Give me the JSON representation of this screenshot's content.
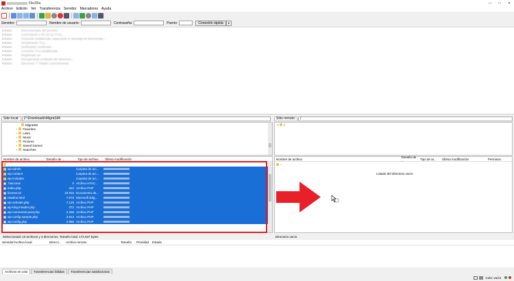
{
  "window": {
    "title": "FileZilla",
    "controls": {
      "minimize": "—",
      "maximize": "□",
      "close": "✕"
    }
  },
  "menu": [
    "Archivo",
    "Edición",
    "Ver",
    "Transferencia",
    "Servidor",
    "Marcadores",
    "Ayuda"
  ],
  "quickconnect": {
    "host_label": "Servidor:",
    "user_label": "Nombre de usuario:",
    "pass_label": "Contraseña:",
    "port_label": "Puerto:",
    "button": "Conexión rápida",
    "dropdown": "▾"
  },
  "log": [
    {
      "k": "Estado:",
      "v": "Desconectado del servidor"
    },
    {
      "k": "Estado:",
      "v": "Conectando a 94.23.12.77:21..."
    },
    {
      "k": "Estado:",
      "v": "Conexión establecida, esperando el mensaje de bienvenida..."
    },
    {
      "k": "Estado:",
      "v": "Inicializando TLS..."
    },
    {
      "k": "Estado:",
      "v": "Verificando certificado..."
    },
    {
      "k": "Estado:",
      "v": "Conexión TLS establecida."
    },
    {
      "k": "Estado:",
      "v": "Registrado en"
    },
    {
      "k": "Estado:",
      "v": "Recuperando el listado del directorio..."
    },
    {
      "k": "Estado:",
      "v": "Directorio \"/\" listado correctamente"
    }
  ],
  "local": {
    "site_label": "Sitio local:",
    "path": "Z:\\Downloads\\MigraSM\\",
    "tree": [
      {
        "label": "MigraSM",
        "indent": 2
      },
      {
        "label": "Favorites",
        "indent": 1
      },
      {
        "label": "Links",
        "indent": 1
      },
      {
        "label": "Music",
        "indent": 1
      },
      {
        "label": "Pictures",
        "indent": 1
      },
      {
        "label": "Saved Games",
        "indent": 1
      },
      {
        "label": "Searches",
        "indent": 1
      }
    ],
    "columns": [
      "Nombre de archivo",
      "Tamaño de ...",
      "Tipo de archivo",
      "Última modificación"
    ],
    "files": [
      {
        "name": "..",
        "size": "",
        "type": "",
        "folder": true,
        "sel": false
      },
      {
        "name": "wp-admin",
        "size": "",
        "type": "Carpeta de arc...",
        "folder": true,
        "sel": true
      },
      {
        "name": "wp-content",
        "size": "",
        "type": "Carpeta de arc...",
        "folder": true,
        "sel": true
      },
      {
        "name": "wp-includes",
        "size": "",
        "type": "Carpeta de arc...",
        "folder": true,
        "sel": true
      },
      {
        "name": ".htaccess",
        "size": "0",
        "type": "Archivo HTAC...",
        "folder": false,
        "sel": true
      },
      {
        "name": "index.php",
        "size": "422",
        "type": "Archivo PHP",
        "folder": false,
        "sel": true
      },
      {
        "name": "license.txt",
        "size": "19.915",
        "type": "Documento de...",
        "folder": false,
        "sel": true
      },
      {
        "name": "readme.html",
        "size": "7.579",
        "type": "Microsoft Edg...",
        "folder": false,
        "sel": true
      },
      {
        "name": "wp-activate.php",
        "size": "7.126",
        "type": "Archivo PHP",
        "folder": false,
        "sel": true
      },
      {
        "name": "wp-blog-header.php",
        "size": "372",
        "type": "Archivo PHP",
        "folder": false,
        "sel": true
      },
      {
        "name": "wp-comments-post.php",
        "size": "2.336",
        "type": "Archivo PHP",
        "folder": false,
        "sel": true
      },
      {
        "name": "wp-config-sample.php",
        "size": "2.913",
        "type": "Archivo PHP",
        "folder": false,
        "sel": true
      },
      {
        "name": "wp-config.php",
        "size": "2.865",
        "type": "Archivo PHP",
        "folder": false,
        "sel": true
      }
    ],
    "status": "Seleccionado 10 archivos y 3 directorios. Tamaño total: 172.537 bytes"
  },
  "remote": {
    "site_label": "Sitio remoto:",
    "path": "/",
    "tree_root": "/",
    "columns": [
      "Nombre de archivo",
      "Tamaño de ...",
      "Tipo de ar...",
      "Última modificación",
      "Permisos"
    ],
    "parent": "..",
    "empty_msg": "Listado del directorio vacío",
    "status": "Directorio vacío."
  },
  "queue": {
    "columns": [
      "Servidor/Archivo local",
      "Direcci...",
      "Archivo remoto",
      "Tamaño",
      "Prioridad",
      "Estado"
    ],
    "tabs": [
      "Archivos en cola",
      "Transferencias fallidas",
      "Transferencias satisfactorias"
    ]
  },
  "statusbar": {
    "queue": "Cola: vacía"
  },
  "colors": {
    "selection": "#1a6fd6",
    "highlight_box": "#e21a1a",
    "arrow": "#e8202a"
  }
}
